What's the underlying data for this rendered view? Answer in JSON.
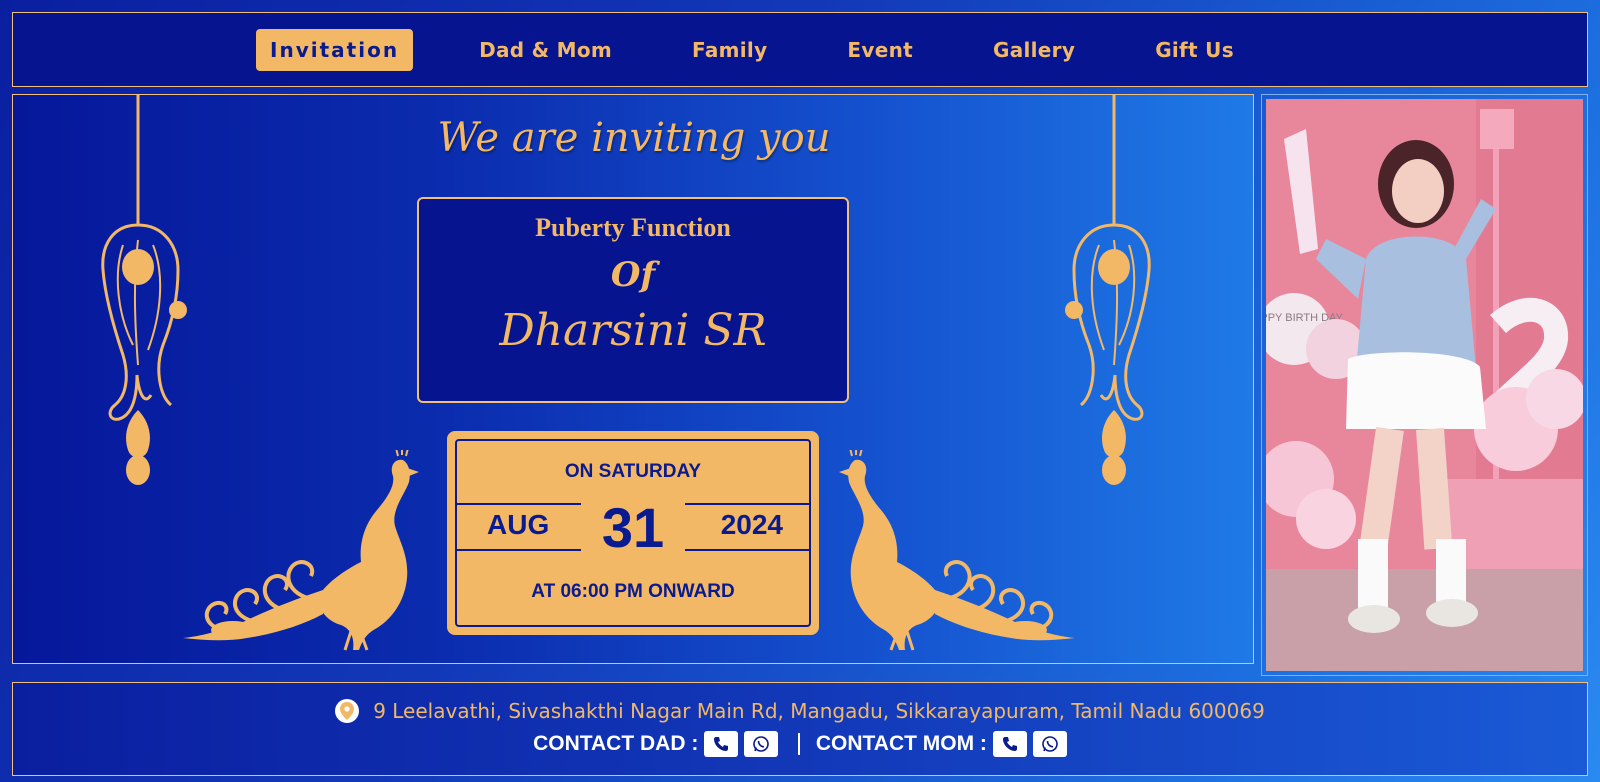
{
  "nav": {
    "items": [
      {
        "label": "Invitation",
        "active": true
      },
      {
        "label": "Dad & Mom",
        "active": false
      },
      {
        "label": "Family",
        "active": false
      },
      {
        "label": "Event",
        "active": false
      },
      {
        "label": "Gallery",
        "active": false
      },
      {
        "label": "Gift Us",
        "active": false
      }
    ]
  },
  "invitation": {
    "headline": "We are inviting you",
    "function_title": "Puberty Function",
    "of": "Of",
    "name": "Dharsini SR"
  },
  "date_card": {
    "day": "ON SATURDAY",
    "month": "AUG",
    "date": "31",
    "year": "2024",
    "time": "AT 06:00 PM ONWARD"
  },
  "photo": {
    "balloon_text": "HAPPY BIRTH DAY"
  },
  "footer": {
    "address": "9 Leelavathi, Sivashakthi Nagar Main Rd, Mangadu, Sikkarayapuram, Tamil Nadu 600069",
    "contact_dad": "CONTACT DAD :",
    "contact_mom": "CONTACT MOM :"
  },
  "icons": {
    "pin": "location-pin-icon",
    "phone": "phone-icon",
    "whatsapp": "whatsapp-icon"
  },
  "colors": {
    "gold": "#f2b866",
    "navy": "#06148f",
    "blue_light": "#1f7ae6"
  }
}
